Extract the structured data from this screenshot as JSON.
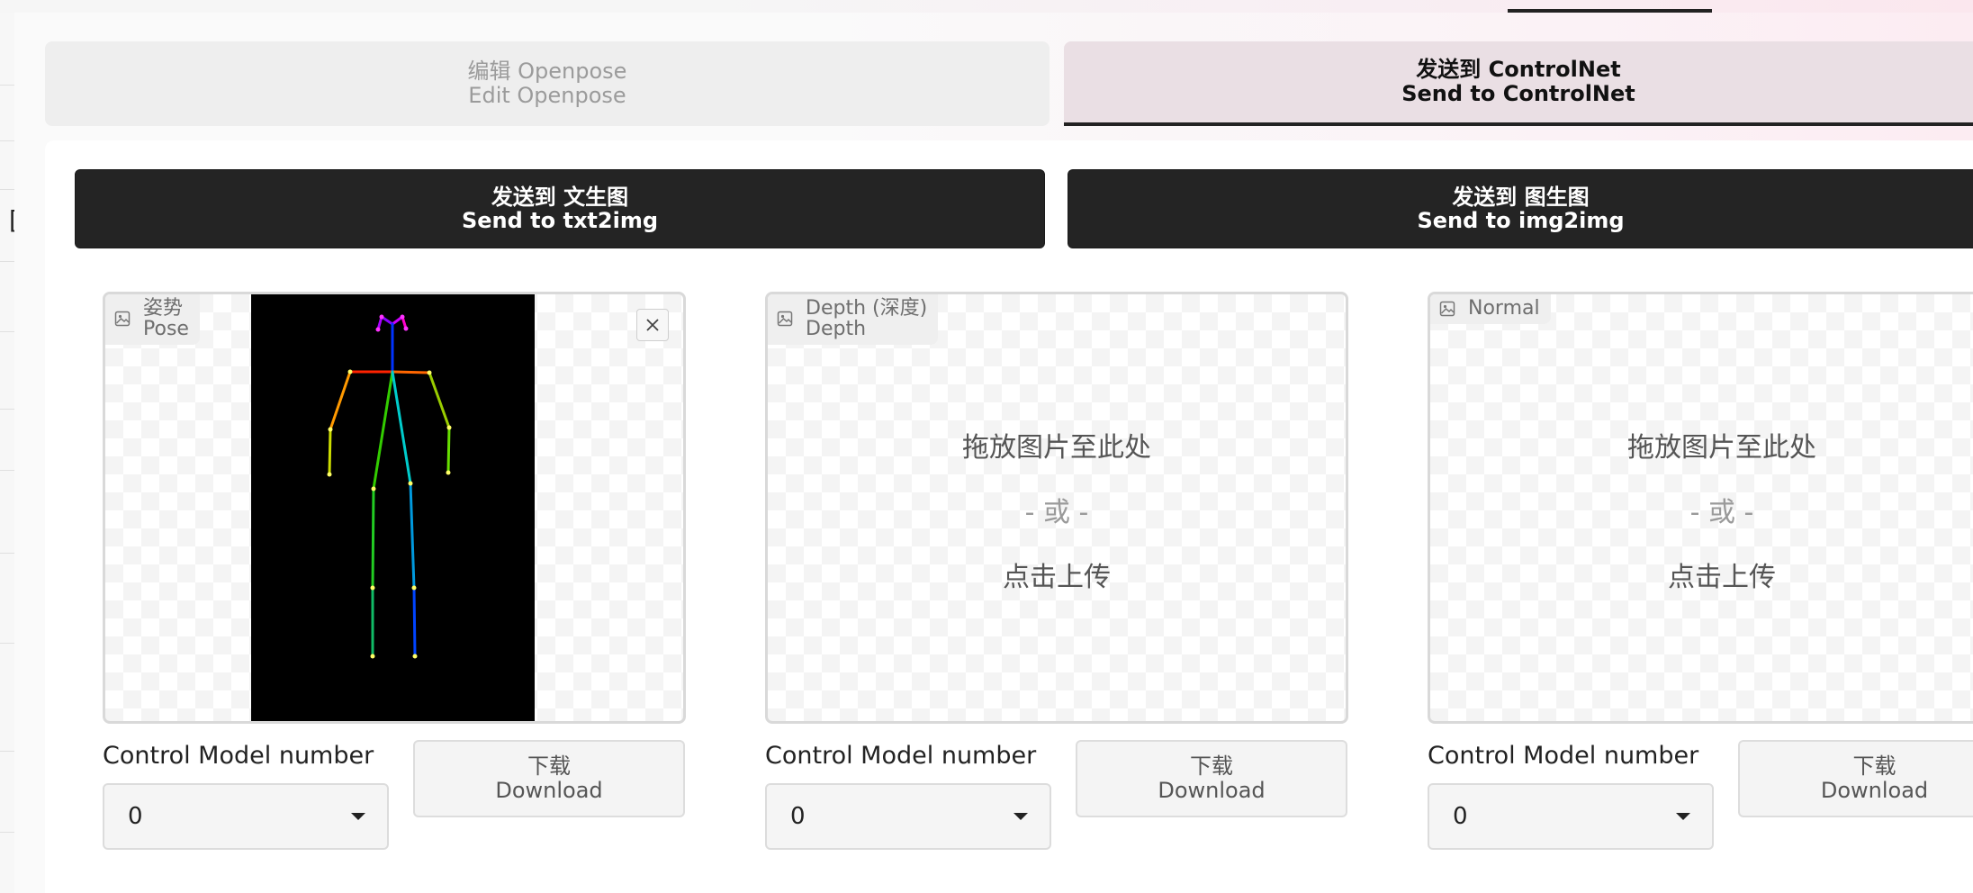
{
  "tabs": [
    {
      "label_cn": "编辑 Openpose",
      "label_en": "Edit Openpose",
      "active": false
    },
    {
      "label_cn": "发送到 ControlNet",
      "label_en": "Send to ControlNet",
      "active": true
    }
  ],
  "send_buttons": {
    "txt2img": {
      "line1": "发送到 文生图",
      "line2": "Send to txt2img"
    },
    "img2img": {
      "line1": "发送到 图生图",
      "line2": "Send to img2img"
    }
  },
  "panels": [
    {
      "label_cn": "姿势",
      "label_en": "Pose",
      "has_image": true,
      "control_label": "Control Model number",
      "control_value": "0",
      "download_cn": "下载",
      "download_en": "Download"
    },
    {
      "label_cn": "Depth (深度)",
      "label_en": "Depth",
      "has_image": false,
      "control_label": "Control Model number",
      "control_value": "0",
      "download_cn": "下载",
      "download_en": "Download"
    },
    {
      "label_cn": "Normal",
      "label_en": "",
      "has_image": false,
      "control_label": "Control Model number",
      "control_value": "0",
      "download_cn": "下载",
      "download_en": "Download"
    }
  ],
  "dropzone": {
    "drop": "拖放图片至此处",
    "or": "- 或 -",
    "click": "点击上传"
  },
  "colors": {
    "dark_button": "#242424",
    "active_tab_underline": "#222222",
    "pose_background": "#000000"
  }
}
